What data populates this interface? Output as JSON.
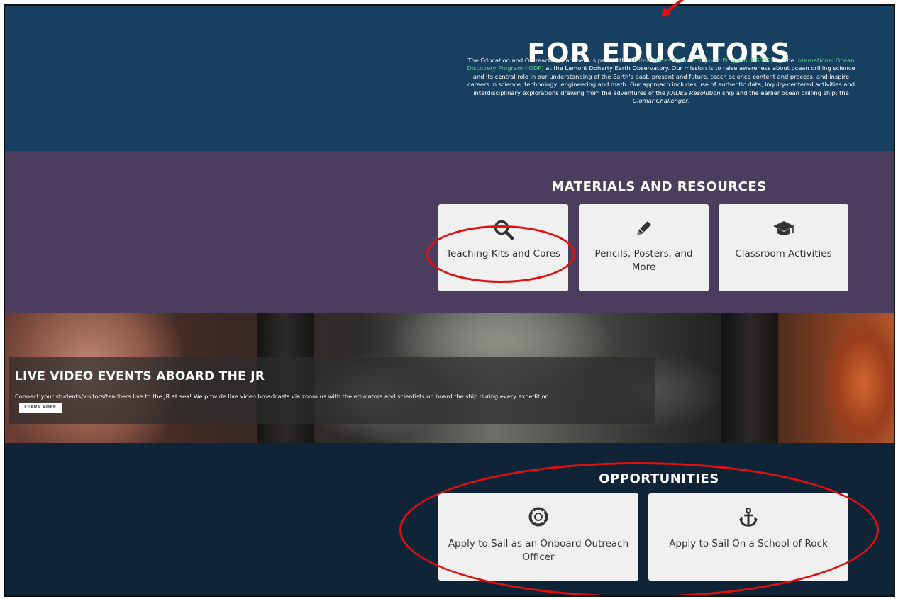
{
  "hero": {
    "title": "FOR EDUCATORS",
    "intro": {
      "t1": "The Education and Outreach Department is part of the ",
      "link1": "United States Science Support Program (USSSP)",
      "t2": " for the ",
      "link2": "International Ocean Discovery Program (IODP)",
      "t3": " at the Lamont Doherty Earth Observatory. Our mission is to raise awareness about ocean drilling science and its central role in our understanding of the Earth's past, present and future, teach science content and process, and inspire careers in science, technology, engineering and math. Our approach includes use of authentic data, inquiry-centered activities and interdisciplinary explorations drawing from the adventures of the ",
      "em1": "JOIDES Resolution",
      "t4": " ship and the earlier ocean drilling ship; the ",
      "em2": "Glomar Challenger",
      "t5": "."
    }
  },
  "materials": {
    "title": "MATERIALS AND RESOURCES",
    "cards": [
      {
        "label": "Teaching Kits and Cores",
        "icon": "search-icon"
      },
      {
        "label": "Pencils, Posters, and More",
        "icon": "pencil-icon"
      },
      {
        "label": "Classroom Activities",
        "icon": "graduation-cap-icon"
      }
    ]
  },
  "video": {
    "title": "LIVE VIDEO EVENTS ABOARD THE JR",
    "text": "Connect your students/visitors/teachers live to the JR at sea! We provide live video broadcasts via zoom.us with the educators and scientists on board the ship during every expedition.",
    "button": "LEARN MORE"
  },
  "opportunities": {
    "title": "OPPORTUNITIES",
    "cards": [
      {
        "label": "Apply to Sail as an Onboard Outreach Officer",
        "icon": "life-ring-icon"
      },
      {
        "label": "Apply to Sail On a School of Rock",
        "icon": "anchor-icon"
      }
    ]
  },
  "colors": {
    "hero_bg": "#173f5f",
    "materials_bg": "#4b3d5e",
    "opportunities_bg": "#0f2437",
    "card_bg": "#f0f0f0",
    "link": "#5fd18c",
    "annotation": "#e01010"
  }
}
